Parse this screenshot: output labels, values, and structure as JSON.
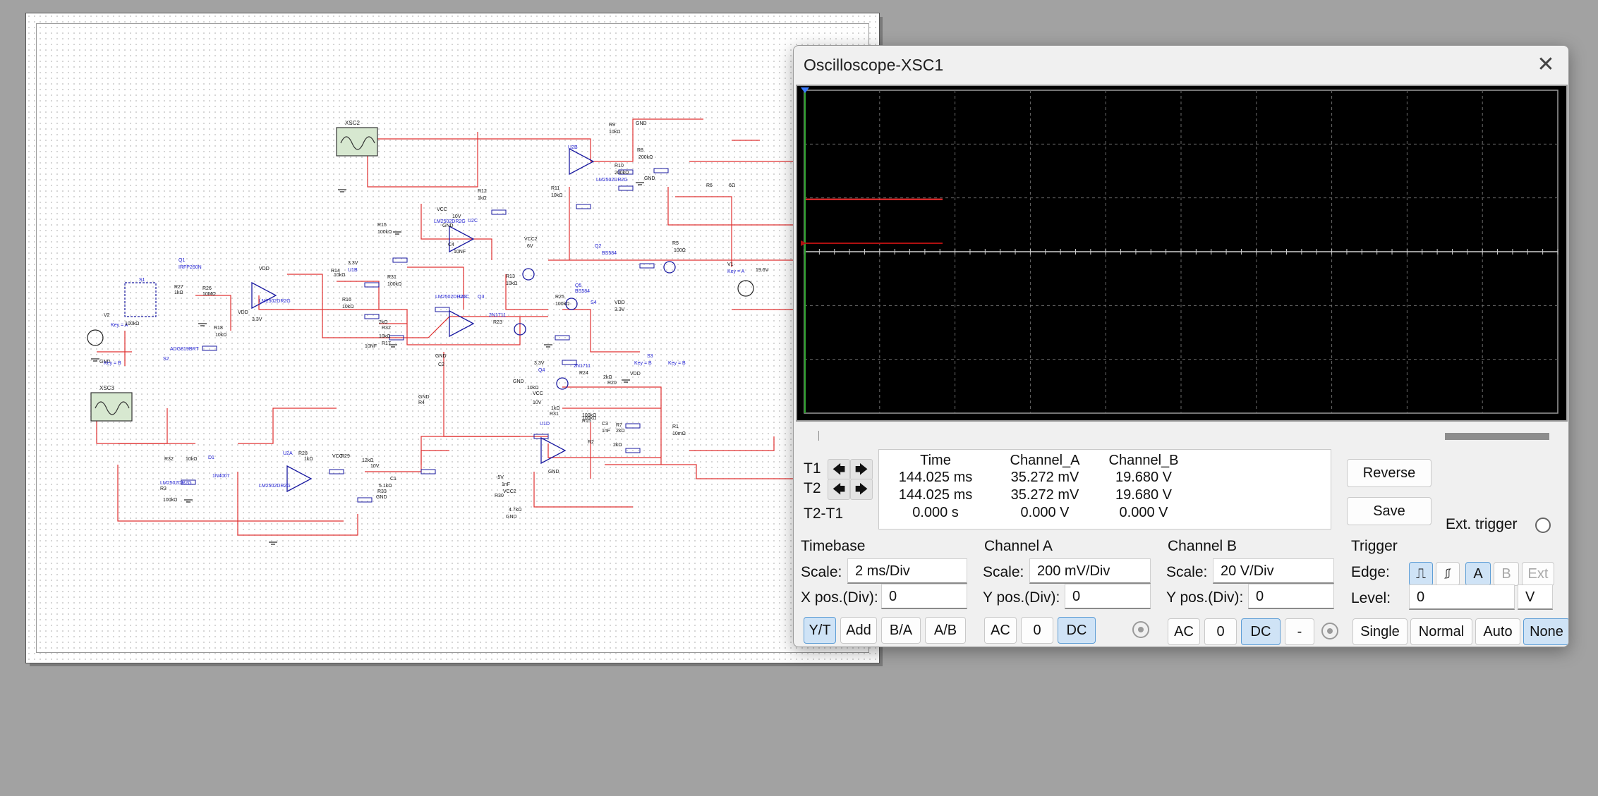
{
  "window": {
    "title": "Oscilloscope-XSC1"
  },
  "colors": {
    "wire": "#e03030",
    "component": "#1a1aa0",
    "label_blue": "#2020d0",
    "trace_a": "#ff3333",
    "trace_b": "#b01010",
    "grid": "#6a6a6a",
    "cursor_t1": "#3a7bff",
    "cursor_t2": "#2c9e2c"
  },
  "schematic": {
    "instruments": [
      {
        "name": "XSC2"
      },
      {
        "name": "XSC3"
      }
    ],
    "labels": [
      "U2B",
      "R9",
      "10kΩ",
      "GND",
      "R8",
      "200kΩ",
      "R10",
      "200kΩ",
      "LM2502DR2G",
      "GND",
      "R11",
      "10kΩ",
      "R12",
      "1kΩ",
      "R6",
      "6Ω",
      "VCC",
      "10V",
      "U2C",
      "LM2502DR2G",
      "GND",
      "R15",
      "100kΩ",
      "C4",
      "10NF",
      "VCC2",
      "6V",
      "Q2",
      "BS584",
      "R5",
      "100Ω",
      "Q1",
      "IRFP260N",
      "VDD",
      "3.3V",
      "U1B",
      "R14",
      "10kΩ",
      "R31",
      "100kΩ",
      "R13",
      "10kΩ",
      "V1",
      "Key = A",
      "19.6V",
      "S1",
      "R27",
      "1kΩ",
      "R26",
      "10MΩ",
      "LM2502DR2G",
      "Q5",
      "BS584",
      "S4",
      "VDD",
      "3.3V",
      "R25",
      "100kΩ",
      "V2",
      "Key = A",
      "GND",
      "R18",
      "10kΩ",
      "VDD",
      "3.3V",
      "R16",
      "10kΩ",
      "U1C",
      "LM2502DR2G",
      "Q3",
      "2N1711",
      "R23",
      "2kΩ",
      "R32",
      "10kΩ",
      "R17",
      "100kΩ",
      "ADG819BRT",
      "S2",
      "Key = B",
      "GND",
      "C2",
      "10NF",
      "GND",
      "Key = B",
      "S3",
      "VDD",
      "Key = B",
      "3.3V",
      "Q4",
      "2N1711",
      "R24",
      "2kΩ",
      "R20",
      "10kΩ",
      "VCC",
      "10V",
      "GND",
      "R4",
      "1kΩ",
      "R31",
      "100kΩ",
      "R15",
      "100kΩ",
      "C3",
      "1nF",
      "R7",
      "2kΩ",
      "R1",
      "10mΩ",
      "U1D",
      "R2",
      "2kΩ",
      "GND",
      "R32",
      "10kΩ",
      "D1",
      "1N4007",
      "U2A",
      "R28",
      "1kΩ",
      "VCC",
      "R29",
      "12kΩ",
      "10V",
      "R33",
      "5.1kΩ",
      "GND",
      "LM2502DR2G",
      "R3",
      "100kΩ",
      "LM2502DR2G",
      "C1",
      "1nF",
      "VCC2",
      "-5V",
      "R30",
      "4.7kΩ",
      "GND"
    ]
  },
  "cursors": {
    "t1_label": "T1",
    "t2_label": "T2",
    "diff_label": "T2-T1",
    "left_arrow": "🡄",
    "right_arrow": "🡆"
  },
  "readout": {
    "headers": [
      "Time",
      "Channel_A",
      "Channel_B"
    ],
    "rows": [
      [
        "144.025 ms",
        "35.272 mV",
        "19.680 V"
      ],
      [
        "144.025 ms",
        "35.272 mV",
        "19.680 V"
      ],
      [
        "0.000 s",
        "0.000 V",
        "0.000 V"
      ]
    ]
  },
  "actions": {
    "reverse": "Reverse",
    "save": "Save",
    "ext_trigger": "Ext. trigger"
  },
  "timebase": {
    "title": "Timebase",
    "scale_label": "Scale:",
    "scale_value": "2 ms/Div",
    "xpos_label": "X pos.(Div):",
    "xpos_value": "0",
    "modes": [
      "Y/T",
      "Add",
      "B/A",
      "A/B"
    ],
    "active_mode": "Y/T"
  },
  "channel_a": {
    "title": "Channel A",
    "scale_label": "Scale:",
    "scale_value": "200 mV/Div",
    "ypos_label": "Y pos.(Div):",
    "ypos_value": "0",
    "coupling": [
      "AC",
      "0",
      "DC"
    ],
    "active": "DC"
  },
  "channel_b": {
    "title": "Channel B",
    "scale_label": "Scale:",
    "scale_value": "20  V/Div",
    "ypos_label": "Y pos.(Div):",
    "ypos_value": "0",
    "coupling": [
      "AC",
      "0",
      "DC",
      "-"
    ],
    "active": "DC"
  },
  "trigger": {
    "title": "Trigger",
    "edge_label": "Edge:",
    "level_label": "Level:",
    "level_value": "0",
    "level_unit": "V",
    "sources": [
      "A",
      "B",
      "Ext"
    ],
    "active_source": "A",
    "modes": [
      "Single",
      "Normal",
      "Auto",
      "None"
    ],
    "active_mode": "None"
  }
}
